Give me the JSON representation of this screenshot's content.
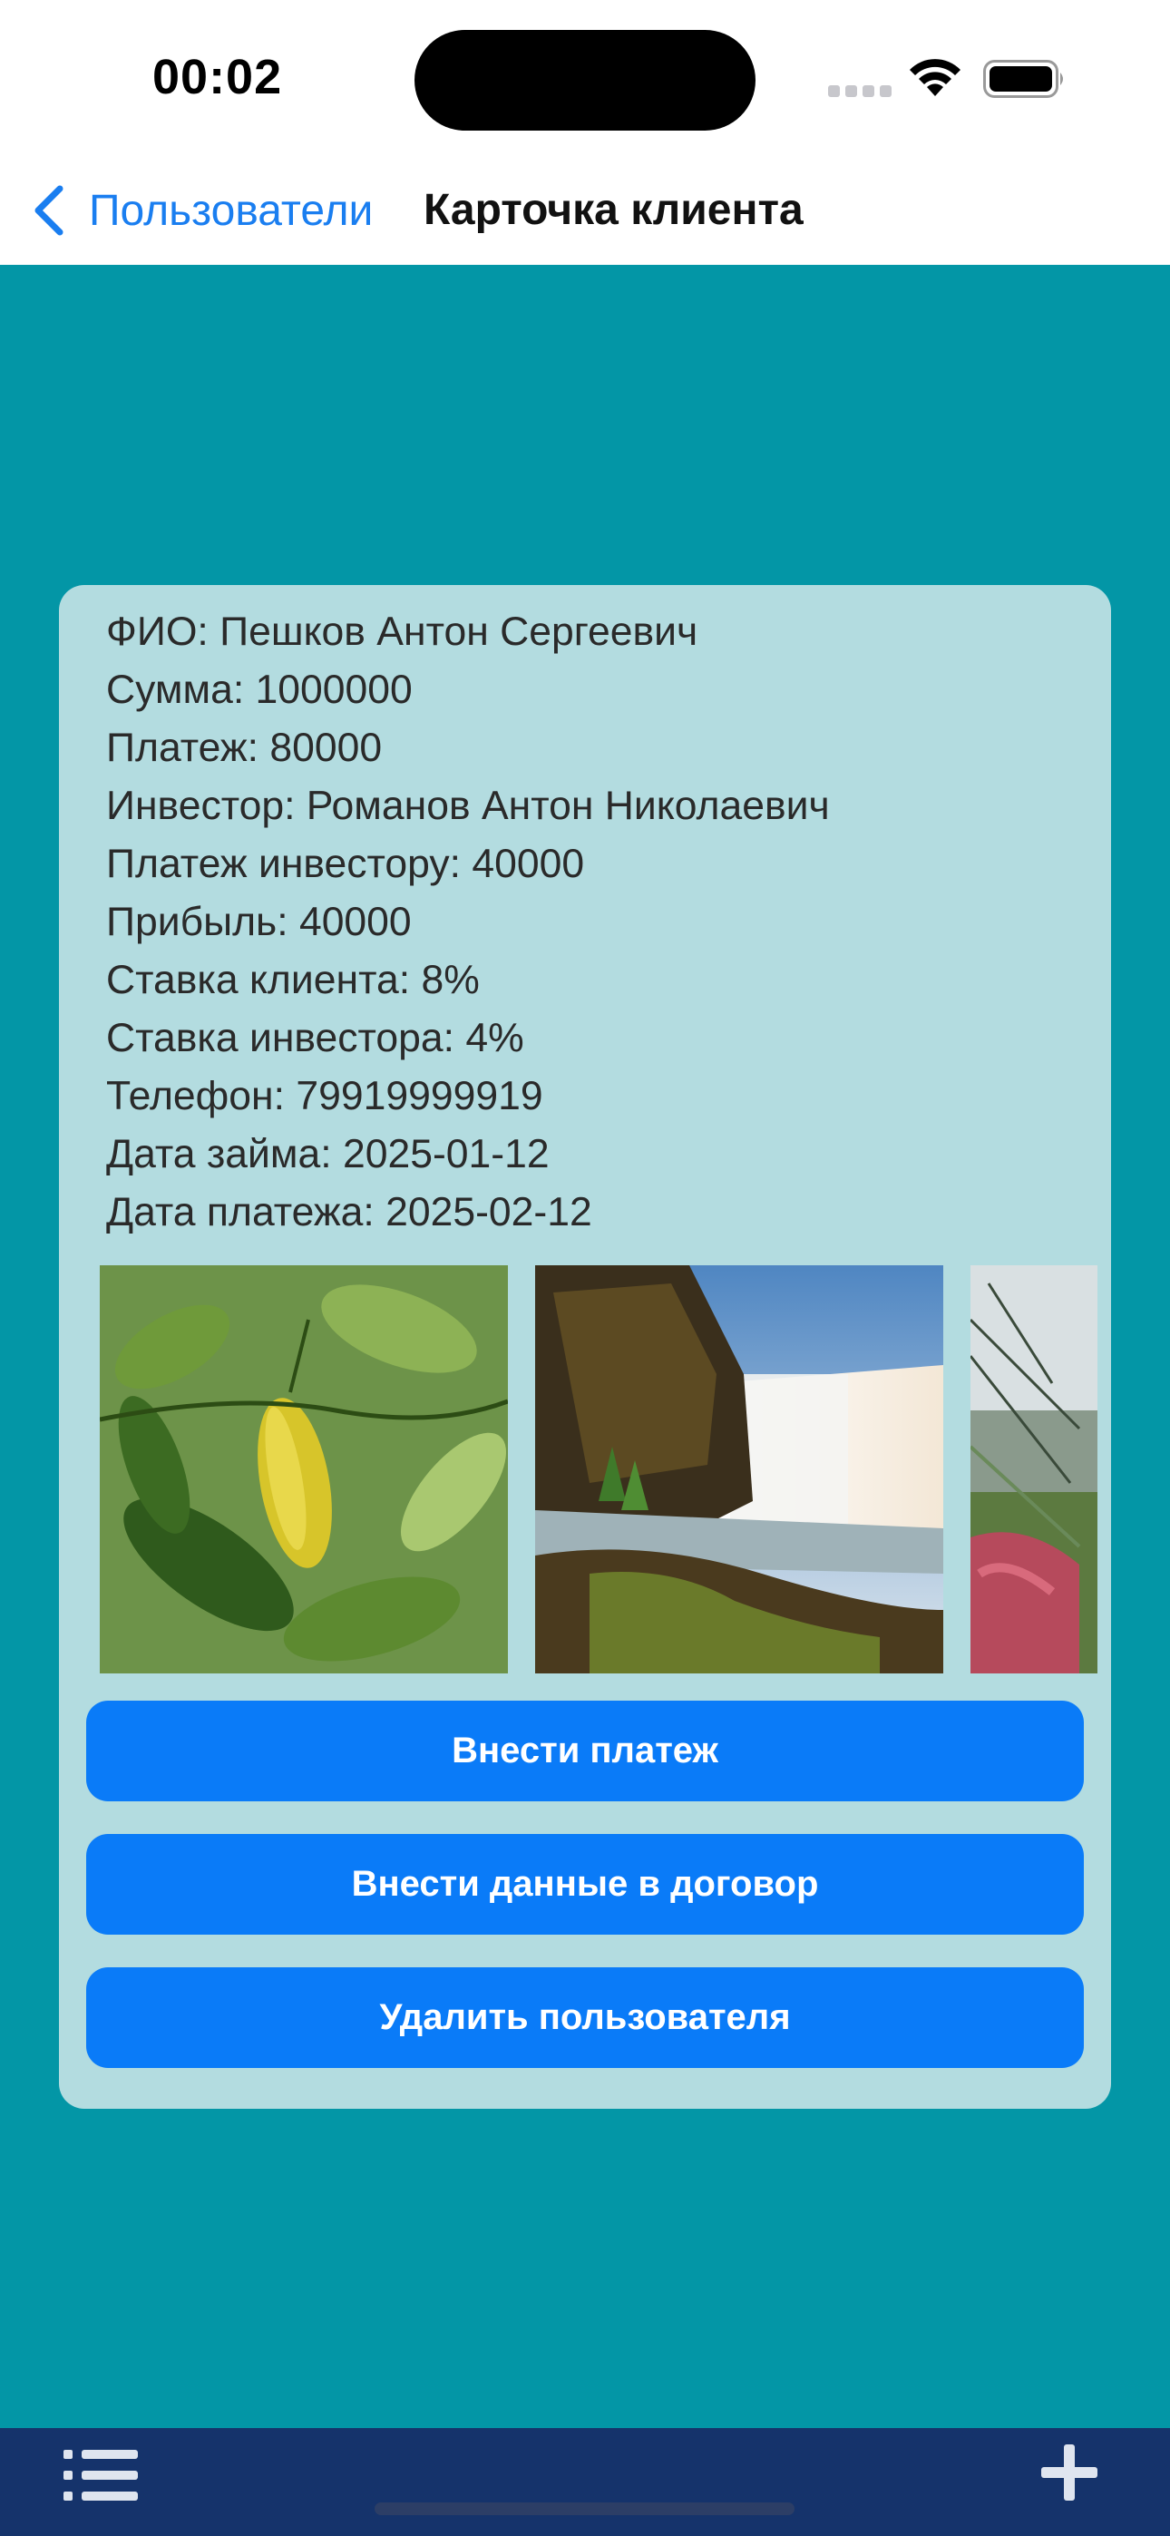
{
  "status_bar": {
    "time": "00:02",
    "icons": [
      "signal-icon",
      "wifi-icon",
      "battery-icon"
    ]
  },
  "nav": {
    "back_label": "Пользователи",
    "title": "Карточка клиента",
    "back_icon": "chevron-left-icon"
  },
  "client": {
    "lines": [
      "ФИО: Пешков Антон Сергеевич",
      "Сумма: 1000000",
      "Платеж: 80000",
      "Инвестор: Романов Антон Николаевич",
      "Платеж инвестору: 40000",
      "Прибыль: 40000",
      "Ставка клиента: 8%",
      "Ставка инвестора: 4%",
      "Телефон: 79919999919",
      "Дата займа: 2025-01-12",
      "Дата платежа: 2025-02-12"
    ]
  },
  "gallery": {
    "photos": [
      "leaves-photo",
      "waterfall-photo",
      "grass-coast-photo"
    ]
  },
  "actions": {
    "add_payment": "Внести платеж",
    "edit_contract": "Внести данные в договор",
    "delete_user": "Удалить пользователя"
  },
  "tab_bar": {
    "left_icon": "list-icon",
    "right_icon": "plus-icon"
  },
  "colors": {
    "background": "#0396a6",
    "card": "#b3dce0",
    "button": "#0a7bf8",
    "tab_bar": "#15336b",
    "link": "#1a7ef0"
  }
}
